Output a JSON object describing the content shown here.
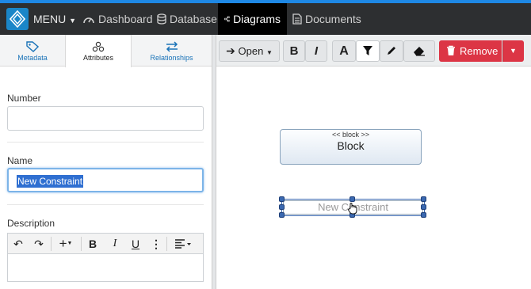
{
  "topbar": {
    "menu_label": "MENU",
    "nav": [
      {
        "label": "Dashboard",
        "icon": "dashboard-icon"
      },
      {
        "label": "Database",
        "icon": "database-icon"
      },
      {
        "label": "Diagrams",
        "icon": "diagram-icon",
        "active": true
      },
      {
        "label": "Documents",
        "icon": "document-icon"
      }
    ]
  },
  "left_panel": {
    "tabs": [
      {
        "label": "Metadata",
        "icon": "tag-icon"
      },
      {
        "label": "Attributes",
        "icon": "attributes-icon",
        "active": true
      },
      {
        "label": "Relationships",
        "icon": "relationships-icon"
      }
    ],
    "fields": {
      "number_label": "Number",
      "number_value": "",
      "name_label": "Name",
      "name_value": "New Constraint",
      "description_label": "Description"
    }
  },
  "toolbar": {
    "open_label": "Open",
    "remove_label": "Remove"
  },
  "canvas": {
    "block": {
      "stereotype": "<< block >>",
      "name": "Block"
    },
    "constraint": {
      "name": "New Constraint"
    }
  },
  "colors": {
    "accent": "#1e88e5",
    "topbar": "#2d2f31",
    "danger": "#dc3545",
    "selection": "#2f6fd1"
  }
}
